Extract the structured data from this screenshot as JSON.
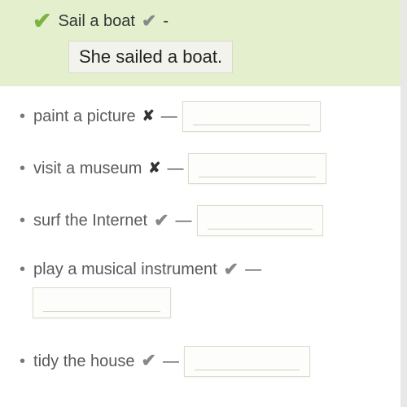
{
  "example": {
    "prompt": "Sail a boat",
    "dash": "-",
    "answer": "She sailed a boat."
  },
  "items": [
    {
      "text": "paint a picture",
      "mark": "x",
      "dash": "—"
    },
    {
      "text": "visit a museum",
      "mark": "x",
      "dash": "—"
    },
    {
      "text": "surf the Internet",
      "mark": "check",
      "dash": "—"
    },
    {
      "text": "play a musical instrument",
      "mark": "check",
      "dash": "—"
    },
    {
      "text": "tidy the house",
      "mark": "check",
      "dash": "—"
    }
  ],
  "glyphs": {
    "check": "✔",
    "x": "✘",
    "bullet": "•"
  }
}
